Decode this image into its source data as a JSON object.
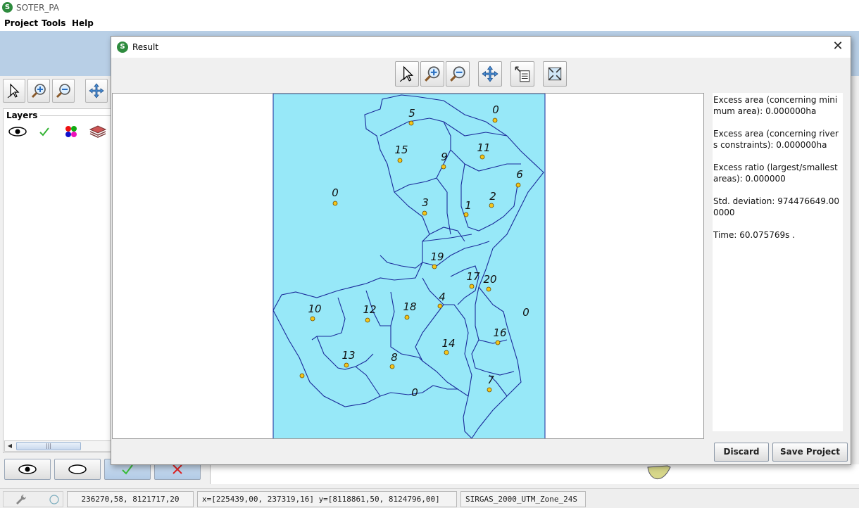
{
  "app": {
    "title": "SOTER_PA",
    "icon": "soter-logo-icon"
  },
  "menu": [
    "Project",
    "Tools",
    "Help"
  ],
  "layers": {
    "header": "Layers"
  },
  "statusbar": {
    "coords": "236270,58, 8121717,20",
    "extent": "x=[225439,00, 237319,16] y=[8118861,50, 8124796,00]",
    "crs": "SIRGAS_2000_UTM_Zone_24S"
  },
  "dialog": {
    "title": "Result",
    "info": [
      "Excess area (concerning minimum area): 0.000000ha",
      "Excess area (concerning rivers constraints): 0.000000ha",
      "Excess ratio (largest/smallest areas): 0.000000",
      "Std. deviation: 974476649.000000",
      "Time: 60.075769s ."
    ],
    "buttons": {
      "discard": "Discard",
      "save": "Save Project"
    }
  },
  "map": {
    "background_color": "#97e8f8",
    "boundary_color": "#1a2a9a",
    "centroid_color": "#f5c518",
    "zone_labels": [
      "5",
      "0",
      "15",
      "9",
      "11",
      "6",
      "0",
      "3",
      "1",
      "2",
      "19",
      "17",
      "20",
      "10",
      "12",
      "18",
      "4",
      "0",
      "16",
      "14",
      "13",
      "8",
      "7",
      "0"
    ]
  },
  "colors": {
    "titlebar_blue": "#b8cfe6",
    "accent_green": "#2e8b3e",
    "reject_red": "#e02020"
  }
}
